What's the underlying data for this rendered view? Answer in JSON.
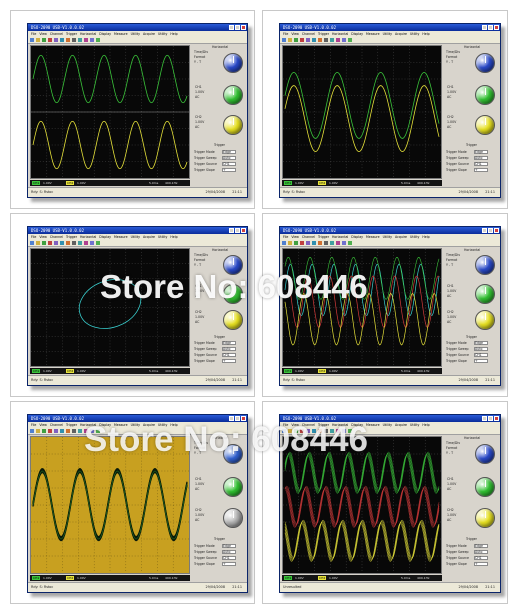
{
  "watermark": {
    "text_1": "Store No: 608446",
    "text_2": "Store No: 608446"
  },
  "windows": [
    {
      "id": "w1",
      "title": "DSO-2090 USB-V1.0.0.02",
      "menus": [
        "File",
        "View",
        "Channel",
        "Trigger",
        "Horizontal",
        "Display",
        "Measure",
        "Utility",
        "Acquire",
        "Utility",
        "Help"
      ],
      "status": "Rdy: S: Rstoc",
      "date": "29/04/2008",
      "time": "21:11"
    },
    {
      "id": "w2",
      "title": "DSO-2090 USB-V1.0.0.02",
      "menus": [
        "File",
        "View",
        "Channel",
        "Trigger",
        "Horizontal",
        "Display",
        "Measure",
        "Utility",
        "Acquire",
        "Utility",
        "Help"
      ],
      "status": "Rdy: S: Rstoc",
      "date": "29/04/2008",
      "time": "21:11"
    },
    {
      "id": "w3",
      "title": "DSO-2090 USB-V1.0.0.02",
      "menus": [
        "File",
        "View",
        "Channel",
        "Trigger",
        "Horizontal",
        "Display",
        "Measure",
        "Utility",
        "Acquire",
        "Utility",
        "Help"
      ],
      "status": "Rdy: S: Rstoc",
      "date": "29/04/2008",
      "time": "21:11"
    },
    {
      "id": "w4",
      "title": "DSO-2090 USB-V1.0.0.02",
      "menus": [
        "File",
        "View",
        "Channel",
        "Trigger",
        "Horizontal",
        "Display",
        "Measure",
        "Utility",
        "Acquire",
        "Utility",
        "Help"
      ],
      "status": "Rdy: S: Rstoc",
      "date": "29/04/2008",
      "time": "21:11"
    },
    {
      "id": "w5",
      "title": "DSO-2090 USB-V1.0.0.02",
      "menus": [
        "File",
        "View",
        "Channel",
        "Trigger",
        "Horizontal",
        "Display",
        "Measure",
        "Utility",
        "Acquire",
        "Utility",
        "Help"
      ],
      "status": "Rdy: S: Rstoc",
      "date": "29/04/2008",
      "time": "21:11"
    },
    {
      "id": "w6",
      "title": "DSO-2090 USB-V1.0.0.02",
      "menus": [
        "File",
        "View",
        "Channel",
        "Trigger",
        "Horizontal",
        "Display",
        "Measure",
        "Utility",
        "Acquire",
        "Utility",
        "Help"
      ],
      "status": "Unresulted",
      "date": "29/04/2008",
      "time": "21:11"
    }
  ],
  "panel": {
    "horizontal_label": "Horizontal",
    "fields": [
      "Time/Div",
      "Format",
      "Y - T"
    ],
    "ch1_label": "CH1",
    "ch2_label": "CH2",
    "volt_value": "1.00V",
    "coupling": "AC",
    "trigger_label": "Trigger",
    "trigger_rows": [
      {
        "name": "Trigger Mode",
        "value": "Edge"
      },
      {
        "name": "Trigger Sweep",
        "value": "Auto"
      },
      {
        "name": "Trigger Source",
        "value": "CH1"
      },
      {
        "name": "Trigger Slope",
        "value": "+"
      }
    ]
  },
  "infobar": {
    "ch1_tag": "CH1",
    "ch1_val": "1.00V",
    "ch2_tag": "CH2",
    "ch2_val": "1.00V",
    "time": "5.0ms",
    "freq": "499.1Hz"
  },
  "colors": {
    "ch1": "#3ac43a",
    "ch2": "#e6e23a",
    "cyan": "#3ad2d2",
    "red": "#d23a3a",
    "yellowbg": "#c8a020"
  }
}
